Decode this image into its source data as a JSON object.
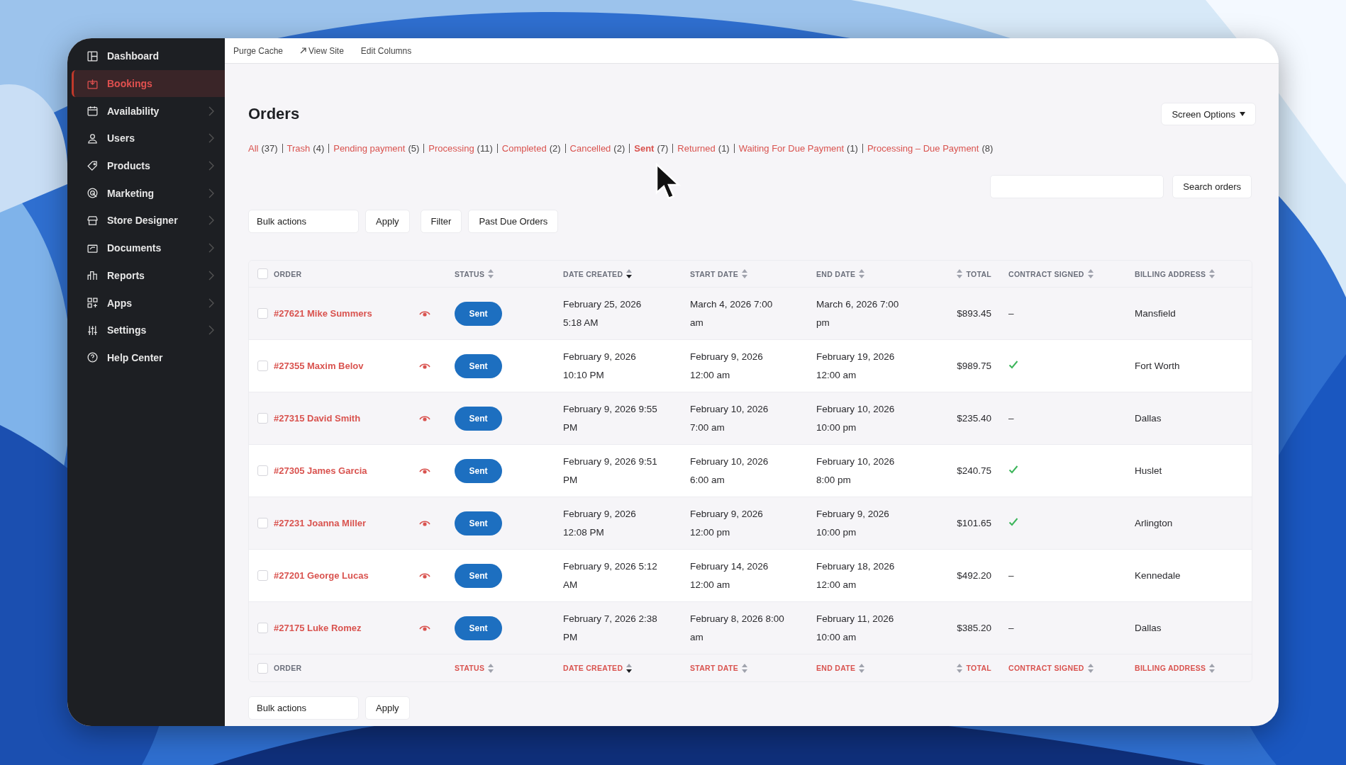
{
  "sidebar": {
    "items": [
      {
        "label": "Dashboard",
        "selected": false,
        "expandable": false
      },
      {
        "label": "Bookings",
        "selected": true,
        "expandable": false
      },
      {
        "label": "Availability",
        "selected": false,
        "expandable": true
      },
      {
        "label": "Users",
        "selected": false,
        "expandable": true
      },
      {
        "label": "Products",
        "selected": false,
        "expandable": true
      },
      {
        "label": "Marketing",
        "selected": false,
        "expandable": true
      },
      {
        "label": "Store Designer",
        "selected": false,
        "expandable": true
      },
      {
        "label": "Documents",
        "selected": false,
        "expandable": true
      },
      {
        "label": "Reports",
        "selected": false,
        "expandable": true
      },
      {
        "label": "Apps",
        "selected": false,
        "expandable": true
      },
      {
        "label": "Settings",
        "selected": false,
        "expandable": true
      },
      {
        "label": "Help Center",
        "selected": false,
        "expandable": false
      }
    ]
  },
  "top_bar": {
    "links": [
      {
        "label": "Purge Cache",
        "external": false
      },
      {
        "label": "View Site",
        "external": true
      },
      {
        "label": "Edit Columns",
        "external": false
      }
    ]
  },
  "title": "Orders",
  "screen_options": "Screen Options",
  "status_filters": [
    {
      "label": "All",
      "count": "(37)",
      "selected": false
    },
    {
      "label": "Trash",
      "count": "(4)",
      "selected": false
    },
    {
      "label": "Pending payment",
      "count": "(5)",
      "selected": false
    },
    {
      "label": "Processing",
      "count": "(11)",
      "selected": false
    },
    {
      "label": "Completed",
      "count": "(2)",
      "selected": false
    },
    {
      "label": "Cancelled",
      "count": "(2)",
      "selected": false
    },
    {
      "label": "Sent",
      "count": "(7)",
      "selected": true
    },
    {
      "label": "Returned",
      "count": "(1)",
      "selected": false
    },
    {
      "label": "Waiting For Due Payment",
      "count": "(1)",
      "selected": false
    },
    {
      "label": "Processing – Due Payment",
      "count": "(8)",
      "selected": false
    }
  ],
  "search": {
    "button": "Search orders"
  },
  "top_actions": {
    "bulk_select": "Bulk actions",
    "apply": "Apply",
    "buttons": [
      "Filter",
      "Past Due Orders"
    ]
  },
  "table": {
    "select_all_checked": false,
    "columns": [
      {
        "label": "ORDER",
        "sortable": false,
        "kind": "text"
      },
      {
        "label": "STATUS",
        "sortable": true,
        "sorted_descending": false,
        "kind": "text"
      },
      {
        "label": "DATE CREATED",
        "sortable": true,
        "sorted_descending": true,
        "kind": "text"
      },
      {
        "label": "START DATE",
        "sortable": true,
        "sorted_descending": false,
        "kind": "text"
      },
      {
        "label": "END DATE",
        "sortable": true,
        "sorted_descending": false,
        "kind": "text"
      },
      {
        "label": "TOTAL",
        "sortable": true,
        "sorted_descending": false,
        "kind": "numeric"
      },
      {
        "label": "CONTRACT SIGNED",
        "sortable": true,
        "sorted_descending": false,
        "kind": "text"
      },
      {
        "label": "BILLING ADDRESS",
        "sortable": true,
        "sorted_descending": false,
        "kind": "text"
      }
    ],
    "rows": [
      {
        "checked": false,
        "order": "#27621 Mike Summers",
        "status": "Sent",
        "date_created": "February 25, 2026 5:18 AM",
        "start_date": "March 4, 2026 7:00 am",
        "end_date": "March 6, 2026 7:00 pm",
        "total": "$893.45",
        "contract": {
          "signed": false,
          "text": "–"
        },
        "billing_address": "Mansfield"
      },
      {
        "checked": false,
        "order": "#27355 Maxim Belov",
        "status": "Sent",
        "date_created": "February 9, 2026 10:10 PM",
        "start_date": "February 9, 2026 12:00 am",
        "end_date": "February 19, 2026 12:00 am",
        "total": "$989.75",
        "contract": {
          "signed": true
        },
        "billing_address": "Fort Worth"
      },
      {
        "checked": false,
        "order": "#27315 David Smith",
        "status": "Sent",
        "date_created": "February 9, 2026 9:55 PM",
        "start_date": "February 10, 2026 7:00 am",
        "end_date": "February 10, 2026 10:00 pm",
        "total": "$235.40",
        "contract": {
          "signed": false,
          "text": "–"
        },
        "billing_address": "Dallas"
      },
      {
        "checked": false,
        "order": "#27305 James Garcia",
        "status": "Sent",
        "date_created": "February 9, 2026 9:51 PM",
        "start_date": "February 10, 2026 6:00 am",
        "end_date": "February 10, 2026 8:00 pm",
        "total": "$240.75",
        "contract": {
          "signed": true
        },
        "billing_address": "Huslet"
      },
      {
        "checked": false,
        "order": "#27231 Joanna Miller",
        "status": "Sent",
        "date_created": "February 9, 2026 12:08 PM",
        "start_date": "February 9, 2026 12:00 pm",
        "end_date": "February 9, 2026 10:00 pm",
        "total": "$101.65",
        "contract": {
          "signed": true
        },
        "billing_address": "Arlington"
      },
      {
        "checked": false,
        "order": "#27201 George Lucas",
        "status": "Sent",
        "date_created": "February 9, 2026 5:12 AM",
        "start_date": "February 14, 2026 12:00 am",
        "end_date": "February 18, 2026 12:00 am",
        "total": "$492.20",
        "contract": {
          "signed": false,
          "text": "–"
        },
        "billing_address": "Kennedale"
      },
      {
        "checked": false,
        "order": "#27175 Luke Romez",
        "status": "Sent",
        "date_created": "February 7, 2026 2:38 PM",
        "start_date": "February 8, 2026 8:00 am",
        "end_date": "February 11, 2026 10:00 am",
        "total": "$385.20",
        "contract": {
          "signed": false,
          "text": "–"
        },
        "billing_address": "Dallas"
      }
    ],
    "footer_select_all_checked": false,
    "footer_columns": [
      {
        "label": "ORDER",
        "sortable": false,
        "kind": "text"
      },
      {
        "label": "STATUS",
        "sortable": true,
        "sorted_descending": false,
        "kind": "text"
      },
      {
        "label": "DATE CREATED",
        "sortable": true,
        "sorted_descending": true,
        "kind": "text"
      },
      {
        "label": "START DATE",
        "sortable": true,
        "sorted_descending": false,
        "kind": "text"
      },
      {
        "label": "END DATE",
        "sortable": true,
        "sorted_descending": false,
        "kind": "text"
      },
      {
        "label": "TOTAL",
        "sortable": true,
        "sorted_descending": false,
        "kind": "numeric"
      },
      {
        "label": "CONTRACT SIGNED",
        "sortable": true,
        "sorted_descending": false,
        "kind": "text"
      },
      {
        "label": "BILLING ADDRESS",
        "sortable": true,
        "sorted_descending": false,
        "kind": "text"
      }
    ]
  },
  "bottom_actions": {
    "bulk_select": "Bulk actions",
    "apply": "Apply"
  }
}
